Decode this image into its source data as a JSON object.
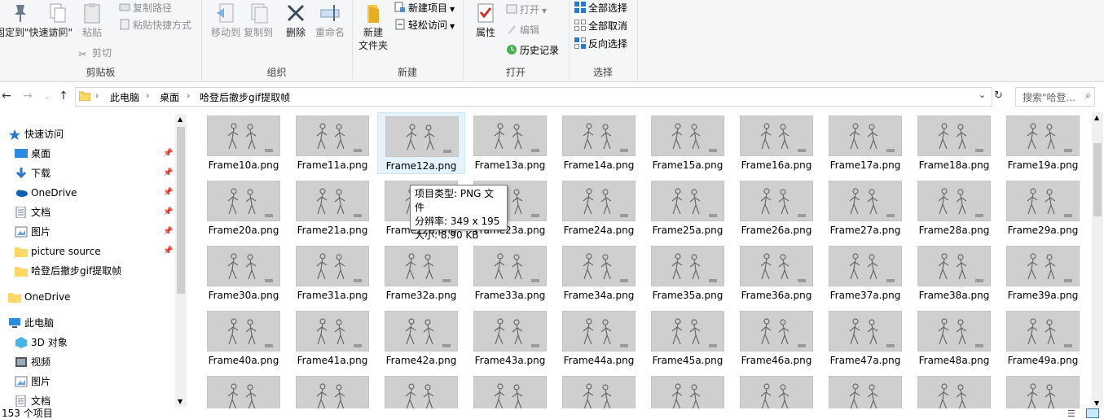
{
  "ribbon": {
    "pin": "固定到\"快速访问\"",
    "copy": "复制",
    "paste": "粘贴",
    "copy_path": "复制路径",
    "paste_shortcut": "粘贴快捷方式",
    "cut": "剪切",
    "clipboard_group": "剪贴板",
    "move_to": "移动到",
    "copy_to": "复制到",
    "delete": "删除",
    "rename": "重命名",
    "organize_group": "组织",
    "new_folder": "新建\n文件夹",
    "new_item": "新建项目",
    "easy_access": "轻松访问",
    "new_group": "新建",
    "properties": "属性",
    "open": "打开",
    "edit": "编辑",
    "history": "历史记录",
    "open_group": "打开",
    "select_all": "全部选择",
    "select_none": "全部取消",
    "invert_selection": "反向选择",
    "select_group": "选择"
  },
  "address": {
    "crumbs": [
      "此电脑",
      "桌面",
      "哈登后撤步gif提取帧"
    ],
    "search_placeholder": "搜索\"哈登...",
    "accent": "#ffd866"
  },
  "sidebar": {
    "items": [
      {
        "label": "快速访问",
        "icon": "star-icon"
      },
      {
        "label": "桌面",
        "icon": "desktop-icon"
      },
      {
        "label": "下载",
        "icon": "download-icon"
      },
      {
        "label": "OneDrive",
        "icon": "cloud-icon"
      },
      {
        "label": "文档",
        "icon": "document-icon"
      },
      {
        "label": "图片",
        "icon": "picture-icon"
      },
      {
        "label": "picture source",
        "icon": "folder-icon"
      },
      {
        "label": "哈登后撤步gif提取帧",
        "icon": "folder-icon"
      },
      {
        "label": "OneDrive",
        "icon": "folder-icon"
      },
      {
        "label": "此电脑",
        "icon": "computer-icon"
      },
      {
        "label": "3D 对象",
        "icon": "cube-icon"
      },
      {
        "label": "视频",
        "icon": "video-icon"
      },
      {
        "label": "图片",
        "icon": "picture-icon"
      },
      {
        "label": "文档",
        "icon": "document-icon"
      }
    ]
  },
  "files": [
    "Frame10a.png",
    "Frame11a.png",
    "Frame12a.png",
    "Frame13a.png",
    "Frame14a.png",
    "Frame15a.png",
    "Frame16a.png",
    "Frame17a.png",
    "Frame18a.png",
    "Frame19a.png",
    "Frame20a.png",
    "Frame21a.png",
    "Frame22a.png",
    "Frame23a.png",
    "Frame24a.png",
    "Frame25a.png",
    "Frame26a.png",
    "Frame27a.png",
    "Frame28a.png",
    "Frame29a.png",
    "Frame30a.png",
    "Frame31a.png",
    "Frame32a.png",
    "Frame33a.png",
    "Frame34a.png",
    "Frame35a.png",
    "Frame36a.png",
    "Frame37a.png",
    "Frame38a.png",
    "Frame39a.png",
    "Frame40a.png",
    "Frame41a.png",
    "Frame42a.png",
    "Frame43a.png",
    "Frame44a.png",
    "Frame45a.png",
    "Frame46a.png",
    "Frame47a.png",
    "Frame48a.png",
    "Frame49a.png",
    "",
    "",
    "",
    "",
    "",
    "",
    "",
    "",
    "",
    ""
  ],
  "selected_file": "Frame12a.png",
  "tooltip": {
    "type": "项目类型: PNG 文件",
    "resolution": "分辨率: 349 x 195",
    "size": "大小: 8.90 KB"
  },
  "status": {
    "count": "153 个项目"
  }
}
